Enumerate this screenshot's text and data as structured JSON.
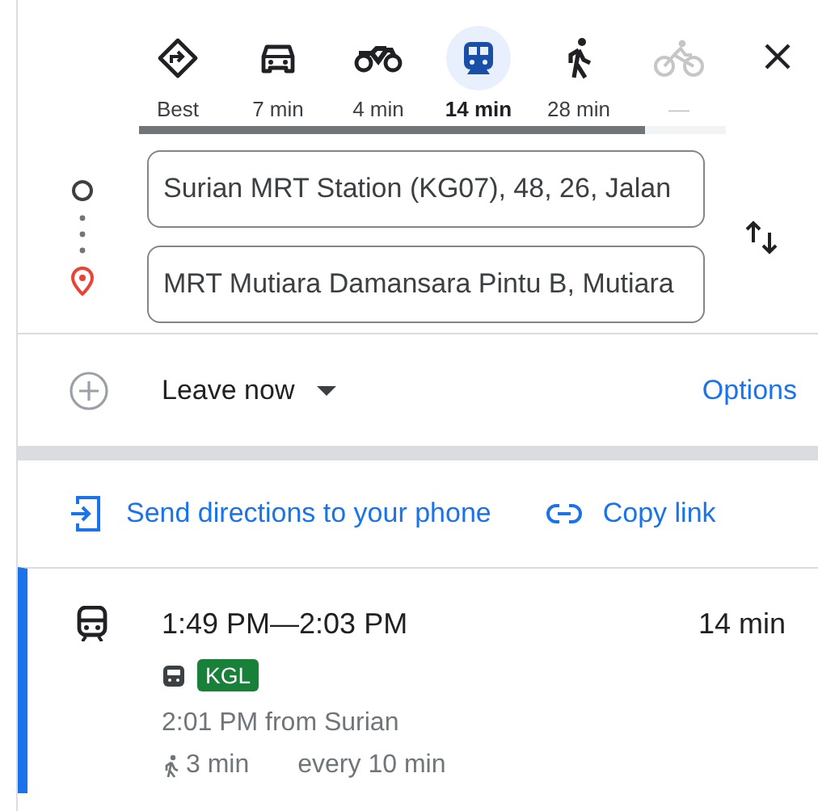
{
  "modes": [
    {
      "kind": "best",
      "label": "Best",
      "selected": false,
      "disabled": false
    },
    {
      "kind": "car",
      "label": "7 min",
      "selected": false,
      "disabled": false
    },
    {
      "kind": "motorcycle",
      "label": "4 min",
      "selected": false,
      "disabled": false
    },
    {
      "kind": "transit",
      "label": "14 min",
      "selected": true,
      "disabled": false
    },
    {
      "kind": "walk",
      "label": "28 min",
      "selected": false,
      "disabled": false
    },
    {
      "kind": "bike",
      "label": "—",
      "selected": false,
      "disabled": true
    }
  ],
  "origin": {
    "value": "Surian MRT Station (KG07), 48, 26, Jalan"
  },
  "destination": {
    "value": "MRT Mutiara Damansara Pintu B, Mutiara"
  },
  "departure": {
    "label": "Leave now",
    "options": "Options"
  },
  "actions": [
    {
      "kind": "send",
      "label": "Send directions to your phone"
    },
    {
      "kind": "copy",
      "label": "Copy link"
    }
  ],
  "route": {
    "selected": true,
    "times": "1:49 PM—2:03 PM",
    "duration": "14 min",
    "line": {
      "label": "KGL",
      "color": "#188038"
    },
    "departure": "2:01 PM from Surian",
    "walk": "3 min",
    "frequency": "every 10 min"
  }
}
